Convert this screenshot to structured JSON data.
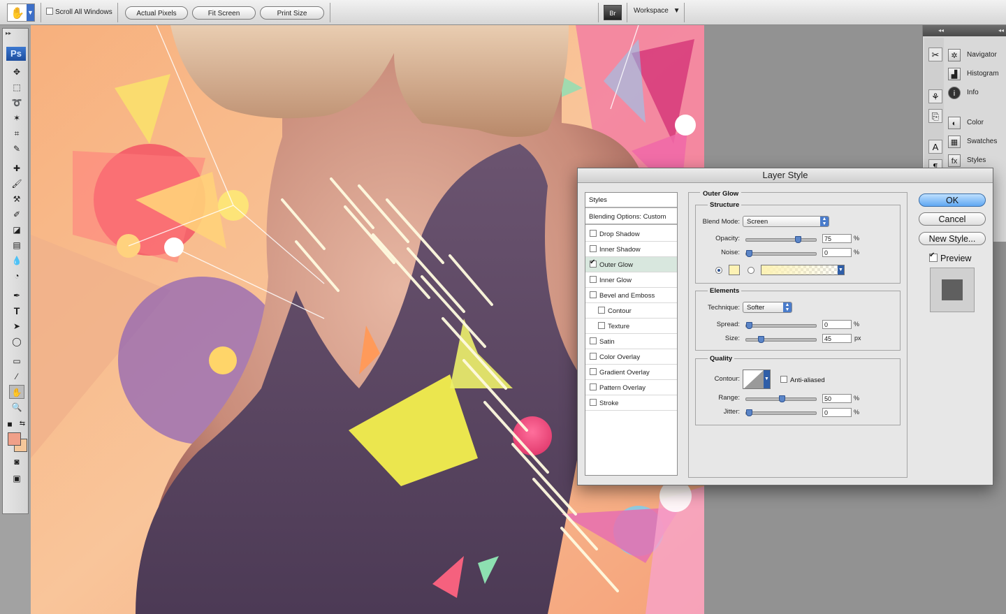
{
  "options_bar": {
    "scroll_all_windows": "Scroll All Windows",
    "actual_pixels": "Actual Pixels",
    "fit_screen": "Fit Screen",
    "print_size": "Print Size",
    "bridge_label": "Br",
    "workspace": "Workspace"
  },
  "tools": {
    "logo": "Ps"
  },
  "panels": {
    "items": [
      {
        "label": "Navigator"
      },
      {
        "label": "Histogram"
      },
      {
        "label": "Info"
      },
      {
        "label": "Color"
      },
      {
        "label": "Swatches"
      },
      {
        "label": "Styles"
      }
    ]
  },
  "dialog": {
    "title": "Layer Style",
    "styles_header": "Styles",
    "blending_options": "Blending Options: Custom",
    "effects": [
      {
        "label": "Drop Shadow",
        "checked": false
      },
      {
        "label": "Inner Shadow",
        "checked": false
      },
      {
        "label": "Outer Glow",
        "checked": true
      },
      {
        "label": "Inner Glow",
        "checked": false
      },
      {
        "label": "Bevel and Emboss",
        "checked": false
      },
      {
        "label": "Contour",
        "checked": false
      },
      {
        "label": "Texture",
        "checked": false
      },
      {
        "label": "Satin",
        "checked": false
      },
      {
        "label": "Color Overlay",
        "checked": false
      },
      {
        "label": "Gradient Overlay",
        "checked": false
      },
      {
        "label": "Pattern Overlay",
        "checked": false
      },
      {
        "label": "Stroke",
        "checked": false
      }
    ],
    "outer_glow": {
      "title": "Outer Glow",
      "structure": {
        "title": "Structure",
        "blend_mode_label": "Blend Mode:",
        "blend_mode_value": "Screen",
        "opacity_label": "Opacity:",
        "opacity_value": "75",
        "opacity_unit": "%",
        "opacity_level": 0.75,
        "noise_label": "Noise:",
        "noise_value": "0",
        "noise_unit": "%",
        "noise_level": 0,
        "glow_color": "#fdf2b4"
      },
      "elements": {
        "title": "Elements",
        "technique_label": "Technique:",
        "technique_value": "Softer",
        "spread_label": "Spread:",
        "spread_value": "0",
        "spread_unit": "%",
        "spread_level": 0,
        "size_label": "Size:",
        "size_value": "45",
        "size_unit": "px",
        "size_level": 0.18
      },
      "quality": {
        "title": "Quality",
        "contour_label": "Contour:",
        "anti_aliased": "Anti-aliased",
        "range_label": "Range:",
        "range_value": "50",
        "range_unit": "%",
        "range_level": 0.5,
        "jitter_label": "Jitter:",
        "jitter_value": "0",
        "jitter_unit": "%",
        "jitter_level": 0
      }
    },
    "buttons": {
      "ok": "OK",
      "cancel": "Cancel",
      "new_style": "New Style...",
      "preview": "Preview"
    }
  },
  "colors": {
    "foreground": "#f0a089",
    "background": "#f5c79a",
    "accent": "#5fa7f2"
  }
}
